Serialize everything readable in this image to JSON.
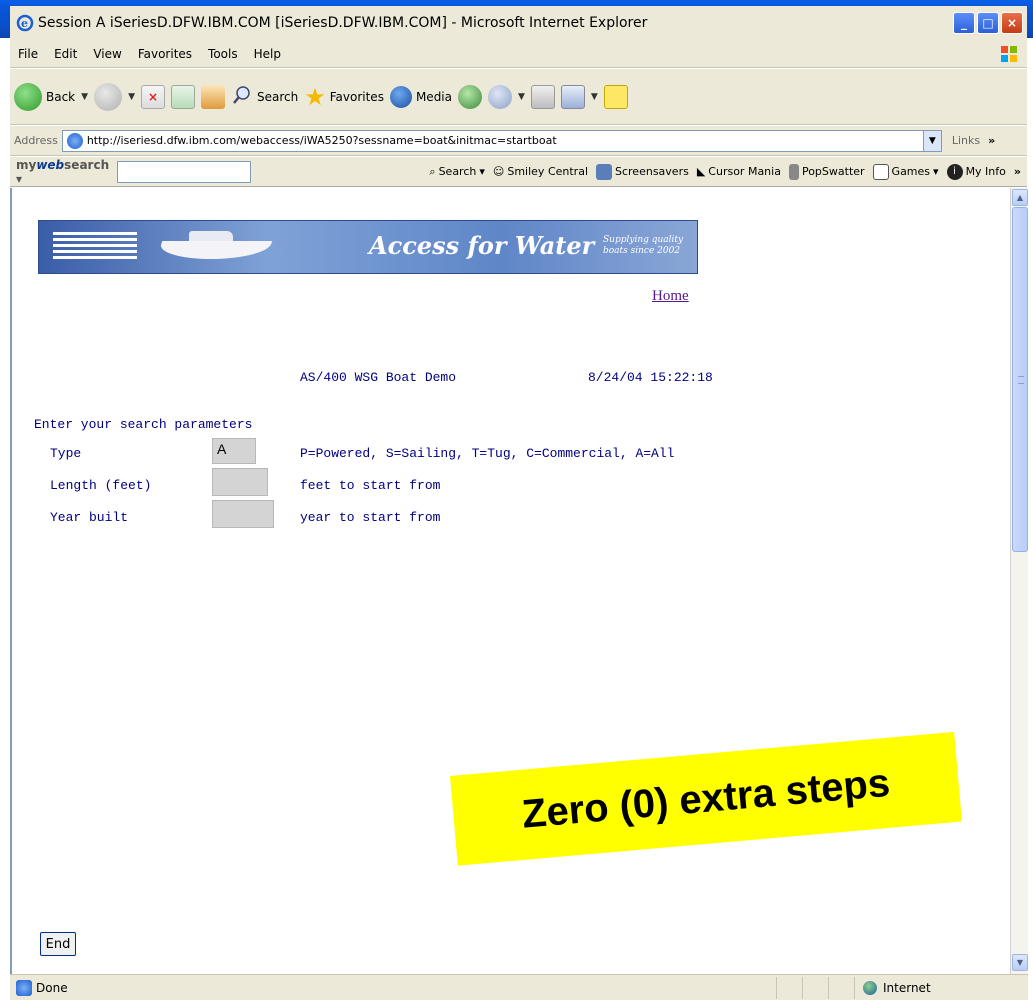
{
  "window": {
    "title": "Session A iSeriesD.DFW.IBM.COM [iSeriesD.DFW.IBM.COM] - Microsoft Internet Explorer"
  },
  "menu": [
    "File",
    "Edit",
    "View",
    "Favorites",
    "Tools",
    "Help"
  ],
  "toolbar": {
    "back": "Back",
    "search": "Search",
    "favorites": "Favorites",
    "media": "Media"
  },
  "address": {
    "label": "Address",
    "url": "http://iseriesd.dfw.ibm.com/webaccess/iWA5250?sessname=boat&initmac=startboat",
    "links": "Links"
  },
  "websearch": {
    "brand_prefix": "my",
    "brand_main": "web",
    "brand_suffix": "search",
    "search": "Search",
    "items": [
      "Smiley Central",
      "Screensavers",
      "Cursor Mania",
      "PopSwatter",
      "Games",
      "My Info"
    ]
  },
  "page": {
    "banner_title": "Access for Water",
    "banner_sub": "Supplying quality boats since 2002",
    "home_link": "Home",
    "app_title": "AS/400 WSG Boat Demo",
    "datetime": "8/24/04 15:22:18",
    "prompt": "Enter your search parameters",
    "fields": [
      {
        "label": "Type",
        "value": "A",
        "hint": "P=Powered, S=Sailing, T=Tug, C=Commercial, A=All"
      },
      {
        "label": "Length (feet)",
        "value": "",
        "hint": "feet to start from"
      },
      {
        "label": "Year built",
        "value": "",
        "hint": "year to start from"
      }
    ],
    "end_button": "End"
  },
  "sticker": {
    "text": "Zero (0) extra steps"
  },
  "status": {
    "left": "Done",
    "zone": "Internet"
  },
  "colors": {
    "xp_titlebar": "#0a5ee8",
    "terminal_text": "#000080",
    "link_visited": "#551a8b",
    "sticker": "#ffff00"
  }
}
